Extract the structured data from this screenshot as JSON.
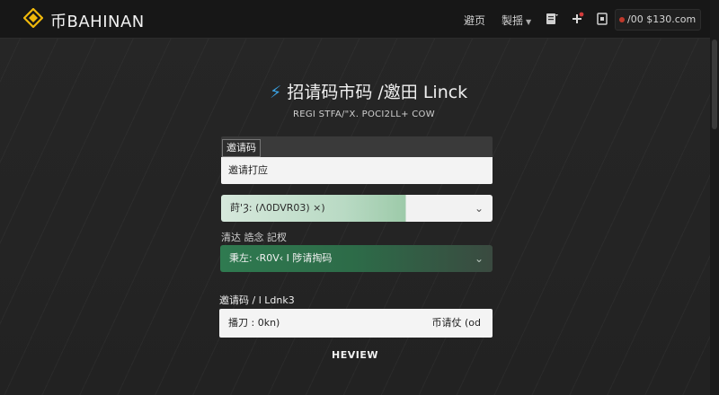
{
  "header": {
    "brand": "币BAHINAN",
    "nav": {
      "home": "避页",
      "menu": "製揺"
    },
    "icons": [
      "logo-diamond-icon",
      "clipboard-icon",
      "plus-icon",
      "file-icon"
    ],
    "account": "/00 $130.com",
    "accent_color": "#f0b90b"
  },
  "page": {
    "title": "招请码市码 /邀田 Linck",
    "subtitle": "REGI STFA/\"X. POCI2LL+ COW"
  },
  "form": {
    "field1": {
      "tag": "邀请码",
      "value": "邀请打应"
    },
    "select1": {
      "value": "莳'Ȝ: (Λ0DVR03) ×)"
    },
    "label2": "清达 誥念 記杈",
    "select2": {
      "value": "秉左: ‹R0V‹ I 陟请掏码"
    },
    "label3": "邀请码 / l Ldnk3",
    "field3": {
      "value": "播刀 : 0kn)",
      "suffix": "币请仗 (od"
    },
    "submit": "HEVIEW"
  }
}
